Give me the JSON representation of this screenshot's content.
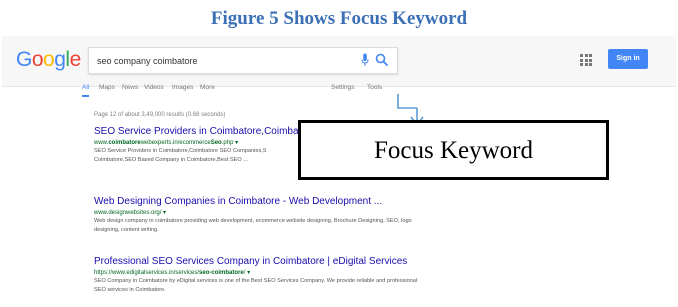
{
  "caption": "Figure 5 Shows Focus Keyword",
  "colors": {
    "caption": "#3b6fb6",
    "link": "#1a0dab",
    "url": "#006621",
    "snippet": "#545454",
    "accent": "#4285f4",
    "pointer": "#5b9bd5"
  },
  "google": {
    "logo": [
      "G",
      "o",
      "o",
      "g",
      "l",
      "e"
    ],
    "search_value": "seo company coimbatore",
    "sign_in": "Sign in"
  },
  "tabs": [
    "All",
    "Maps",
    "News",
    "Videos",
    "Images",
    "More",
    "Settings",
    "Tools"
  ],
  "stats": "Page 12 of about 3,49,000 results (0.68 seconds)",
  "results": [
    {
      "title": "SEO Service Providers in Coimbatore,Coimbatore S",
      "url_pre": "www.",
      "url_bold": "coimbatore",
      "url_mid": "webexperts.in/ecommerce",
      "url_bold2": "Seo",
      "url_post": ".php",
      "arrow": "▾",
      "snippet": "SEO Service Providers in Coimbatore,Coimbatore SEO Companies,S Coimbatore,SEO Based Company in Coimbatore,Best SEO ..."
    },
    {
      "title": "Web Designing Companies in Coimbatore - Web Development ...",
      "url": "www.designwebsites.org/",
      "arrow": "▾",
      "snippet": "Web design company in coimbatore providing web development, ecommerce website designing, Brochure Designing, SEO, logo designing, content writing."
    },
    {
      "title": "Professional SEO Services Company in Coimbatore | eDigital Services",
      "url_pre": "https://www.edigitalservices.in/services/",
      "url_bold": "seo-coimbatore",
      "url_post": "/",
      "arrow": "▾",
      "snippet": "SEO Company in Coimbatore by eDigital services is one of the Best SEO Services Company. We provide reliable and professional SEO services in Coimbatore."
    }
  ],
  "callout": "Focus Keyword"
}
